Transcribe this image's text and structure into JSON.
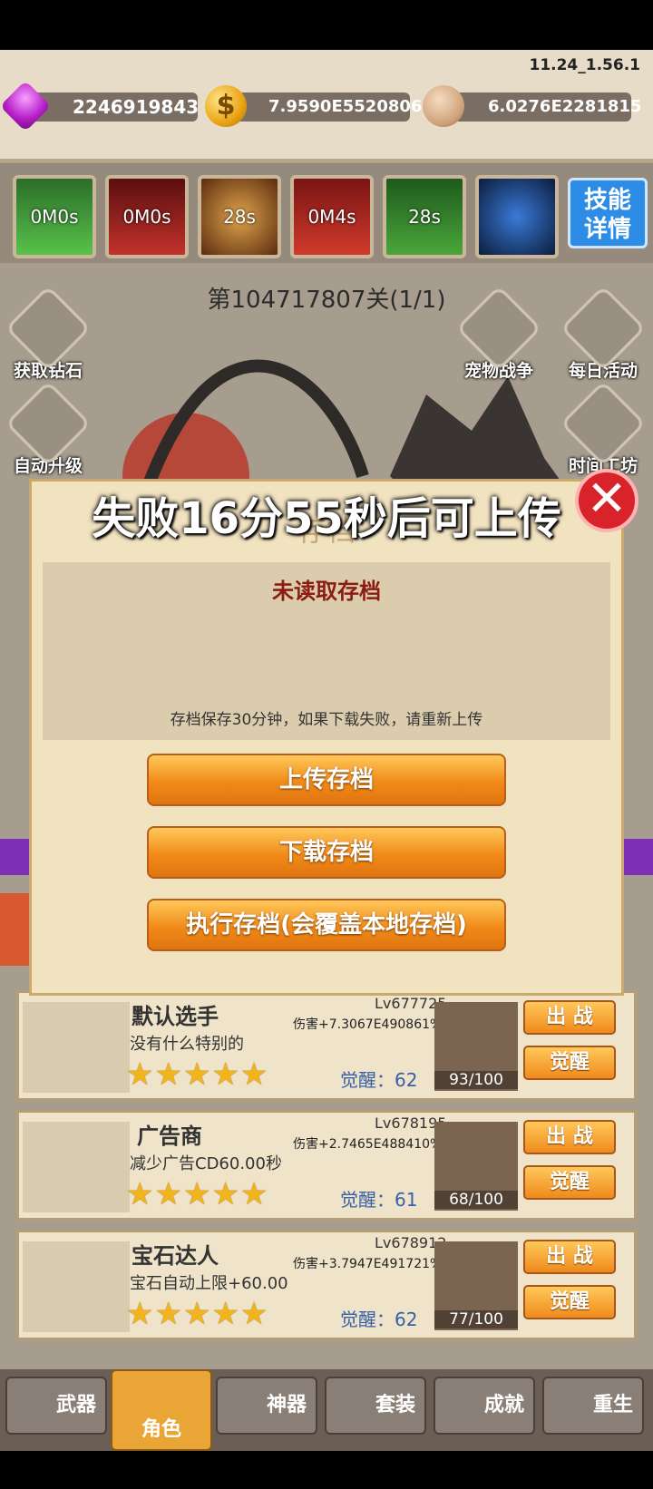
{
  "version": "11.24_1.56.1",
  "resources": {
    "gems": "2246919843",
    "gold": "7.9590E5520806",
    "skulls": "6.0276E2281815"
  },
  "skills": [
    "0M0s",
    "0M0s",
    "28s",
    "0M4s",
    "28s",
    ""
  ],
  "skill_detail_button": "技能详情",
  "stage_label": "第104717807关(1/1)",
  "side_buttons": {
    "get_gems": "获取钻石",
    "auto_upgrade": "自动升级",
    "pet_war": "宠物战争",
    "daily_events": "每日活动",
    "time_workshop": "时间工坊"
  },
  "dialog": {
    "title": "存档",
    "heading": "未读取存档",
    "note": "存档保存30分钟，如果下载失败，请重新上传",
    "upload_button": "上传存档",
    "download_button": "下载存档",
    "apply_button": "执行存档(会覆盖本地存档)"
  },
  "banner": "失败16分55秒后可上传",
  "heroes": [
    {
      "name": "默认选手",
      "level": "Lv677725",
      "damage": "伤害+7.3067E490861%",
      "description": "没有什么特别的",
      "stars": "★★★★★",
      "awakening": "觉醒：62",
      "cards": "93/100",
      "deploy": "出 战",
      "awaken": "觉醒"
    },
    {
      "name": "广告商",
      "level": "Lv678195",
      "damage": "伤害+2.7465E488410%",
      "description": "减少广告CD60.00秒",
      "stars": "★★★★★",
      "awakening": "觉醒：61",
      "cards": "68/100",
      "deploy": "出 战",
      "awaken": "觉醒"
    },
    {
      "name": "宝石达人",
      "level": "Lv678912",
      "damage": "伤害+3.7947E491721%",
      "description": "宝石自动上限+60.00",
      "stars": "★★★★★",
      "awakening": "觉醒：62",
      "cards": "77/100",
      "deploy": "出 战",
      "awaken": "觉醒"
    }
  ],
  "tabs": [
    "武器",
    "角色",
    "神器",
    "套装",
    "成就",
    "重生"
  ],
  "colors": {
    "accent_orange": "#f08a18",
    "dialog_bg": "#f1e2c0",
    "heading_red": "#8a1c12",
    "skill_blue": "#2d8de6"
  }
}
